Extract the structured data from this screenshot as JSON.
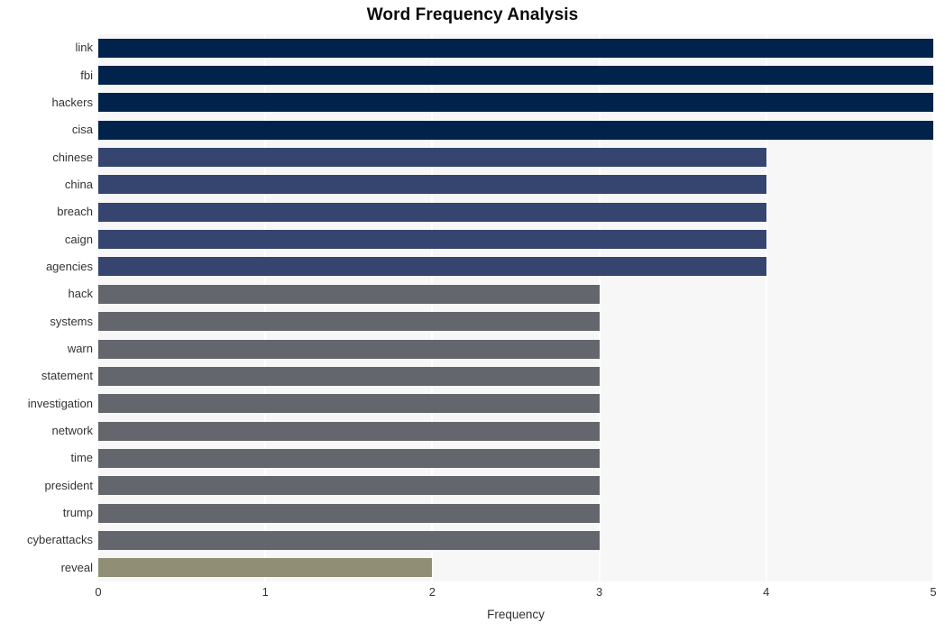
{
  "chart_data": {
    "type": "bar",
    "orientation": "horizontal",
    "title": "Word Frequency Analysis",
    "xlabel": "Frequency",
    "ylabel": "",
    "xlim": [
      0,
      5
    ],
    "xticks": [
      0,
      1,
      2,
      3,
      4,
      5
    ],
    "xtick_labels": [
      "0",
      "1",
      "2",
      "3",
      "4",
      "5"
    ],
    "grid": true,
    "grid_axis": "x",
    "legend": false,
    "categories": [
      "link",
      "fbi",
      "hackers",
      "cisa",
      "chinese",
      "china",
      "breach",
      "caign",
      "agencies",
      "hack",
      "systems",
      "warn",
      "statement",
      "investigation",
      "network",
      "time",
      "president",
      "trump",
      "cyberattacks",
      "reveal"
    ],
    "values": [
      5,
      5,
      5,
      5,
      4,
      4,
      4,
      4,
      4,
      3,
      3,
      3,
      3,
      3,
      3,
      3,
      3,
      3,
      3,
      2
    ],
    "bar_colors": [
      "#01234b",
      "#01234b",
      "#01234b",
      "#01234b",
      "#36456f",
      "#36456f",
      "#36456f",
      "#36456f",
      "#36456f",
      "#64666e",
      "#64666e",
      "#64666e",
      "#64666e",
      "#64666e",
      "#64666e",
      "#64666e",
      "#64666e",
      "#64666e",
      "#64666e",
      "#918e76"
    ],
    "plot_background": "#f7f7f7",
    "gridline_color": "#ffffff",
    "figure_background": "#ffffff"
  }
}
